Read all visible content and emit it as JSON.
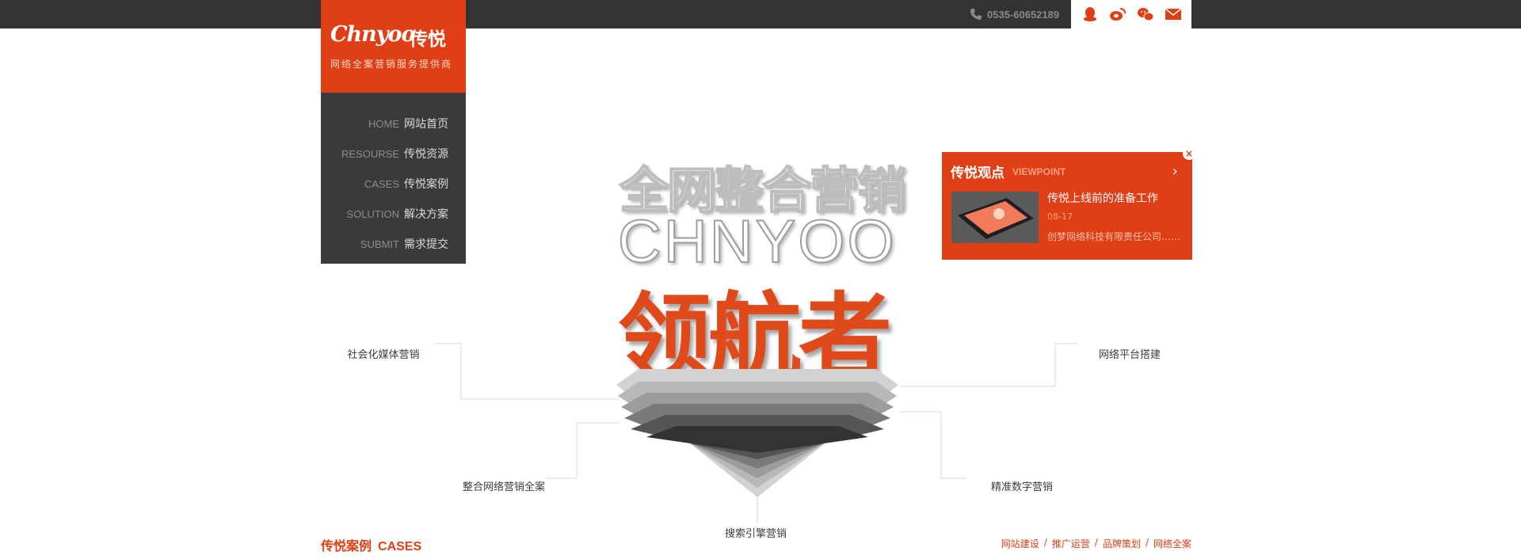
{
  "header": {
    "phone": "0535-60652189",
    "social_icons": [
      "qq-icon",
      "weibo-icon",
      "wechat-icon",
      "mail-icon"
    ]
  },
  "brand": {
    "logo_en": "Chnyoo",
    "logo_cn": "传悦",
    "slogan": "网络全案营销服务提供商"
  },
  "nav": {
    "items": [
      {
        "en": "HOME",
        "cn": "网站首页"
      },
      {
        "en": "RESOURSE",
        "cn": "传悦资源"
      },
      {
        "en": "CASES",
        "cn": "传悦案例"
      },
      {
        "en": "SOLUTION",
        "cn": "解决方案"
      },
      {
        "en": "SUBMIT",
        "cn": "需求提交"
      }
    ]
  },
  "hero": {
    "line1": "全网整合营销",
    "line2": "CHNYOO",
    "line3": "领航者",
    "tags": {
      "social": "社会化媒体营销",
      "platform": "网络平台搭建",
      "integrated": "整合网络营销全案",
      "digital": "精准数字营销",
      "search": "搜索引擎营销"
    }
  },
  "viewpoint": {
    "title": "传悦观点",
    "subtitle": "VIEWPOINT",
    "close": "×",
    "arrow": "›",
    "headline": "传悦上线前的准备工作",
    "date": "08-17",
    "desc": "创梦网络科技有限责任公司……"
  },
  "cases": {
    "title_cn": "传悦案例",
    "title_en": "CASES",
    "links": [
      "网站建设",
      "推广运营",
      "品牌策划",
      "网络全案"
    ],
    "separator": "/"
  },
  "colors": {
    "accent": "#e03e14",
    "dark_bar": "#333333",
    "nav_bg": "#3a3a3a"
  }
}
